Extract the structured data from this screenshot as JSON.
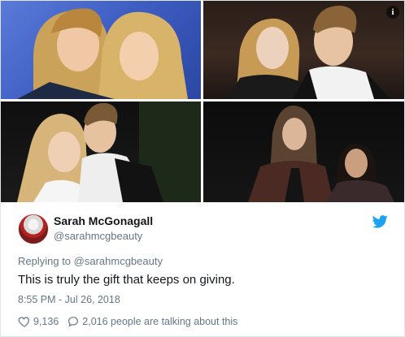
{
  "tweet": {
    "author_name": "Sarah McGonagall",
    "author_handle": "@sarahmcgbeauty",
    "replying_prefix": "Replying to ",
    "replying_to": "@sarahmcgbeauty",
    "text": "This is truly the gift that keeps on giving.",
    "timestamp": "8:55 PM - Jul 26, 2018",
    "likes": "9,136",
    "talking": "2,016 people are talking about this",
    "info_icon": "info-icon",
    "brand_color": "#1da1f2"
  }
}
